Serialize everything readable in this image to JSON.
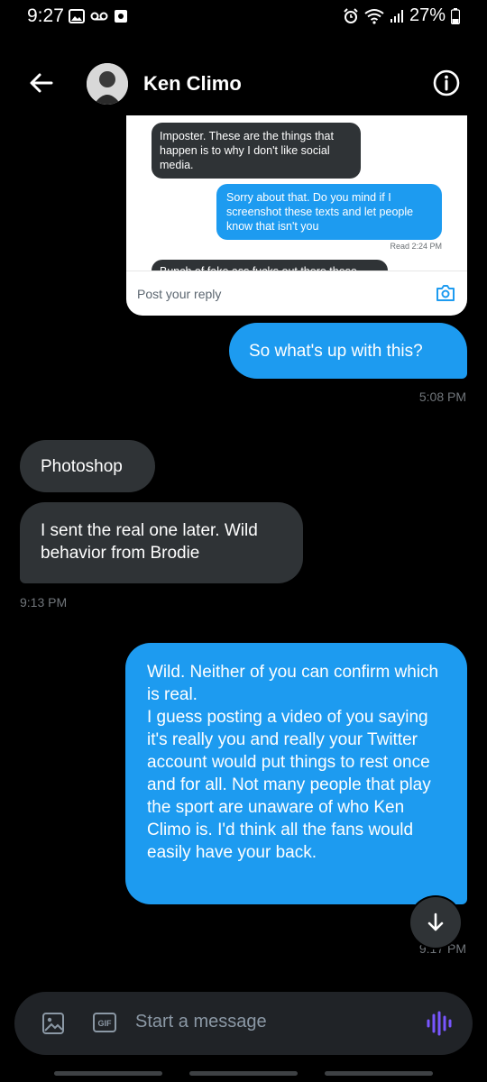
{
  "status_bar": {
    "time": "9:27",
    "battery": "27%",
    "icons": [
      "gallery-icon",
      "voicemail-icon",
      "app-icon",
      "alarm-icon",
      "wifi-icon",
      "signal-icon",
      "battery-icon"
    ]
  },
  "header": {
    "contact_name": "Ken Climo",
    "back_icon": "back-arrow-icon",
    "info_icon": "info-icon"
  },
  "shared_card": {
    "received_text": "Imposter. These are the things that happen is to why I don't like social media.",
    "sent_text": "Sorry about that. Do you mind if I screenshot these texts and let people know that isn't you",
    "read_receipt": "Read 2:24 PM",
    "cut_text": "Bunch of fake ass fucks out there these",
    "reply_placeholder": "Post your reply"
  },
  "messages": [
    {
      "direction": "sent",
      "text": "So what's up with this?"
    },
    {
      "direction": "received",
      "text": "Photoshop"
    },
    {
      "direction": "received",
      "text": "I sent the real one later. Wild behavior from Brodie"
    },
    {
      "direction": "sent",
      "text": "Wild. Neither of you can confirm which is real.\nI guess posting a video of you saying it's really you and really your Twitter account would put things to rest once and for all. Not many people that play the sport are unaware of who Ken Climo is. I'd think all the fans would easily have your back."
    }
  ],
  "timestamps": [
    "5:08 PM",
    "9:13 PM",
    "9:17 PM"
  ],
  "composer": {
    "placeholder": "Start a message",
    "gif_label": "GIF"
  },
  "colors": {
    "background": "#000000",
    "sent_bubble": "#1d9bf0",
    "received_bubble": "#2f3336",
    "timestamp": "#71767b",
    "voice_accent": "#7856ff"
  }
}
